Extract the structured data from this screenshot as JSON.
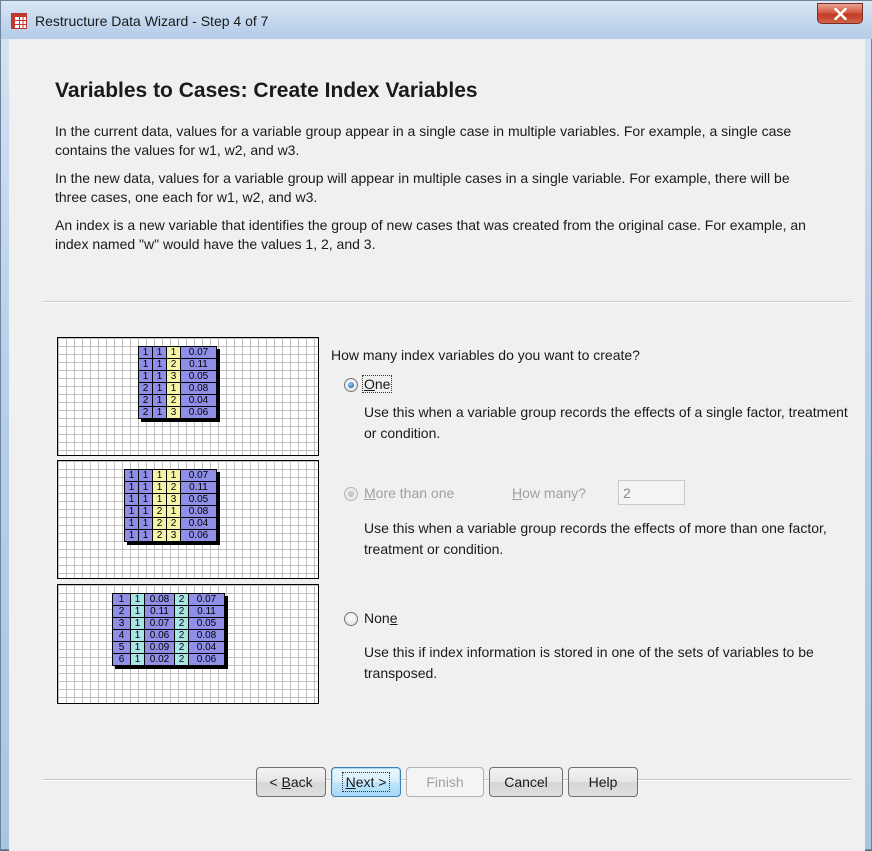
{
  "window": {
    "title": "Restructure Data Wizard - Step 4 of 7",
    "icon": "spreadsheet-icon",
    "close_icon": "close-icon"
  },
  "page": {
    "title": "Variables to Cases: Create Index Variables",
    "para1": "In the current data, values for a variable group appear in a single case in multiple variables.  For example, a single case contains the values for w1, w2, and w3.",
    "para2": "In the new data, values for a variable group will appear in multiple cases in a single variable.  For example, there will be three cases, one each for w1, w2, and w3.",
    "para3": "An index is a new variable that identifies the group of new cases that was created from the original case.  For example, an index named \"w\" would have the values 1, 2, and 3."
  },
  "diagrams": {
    "one": [
      [
        "1",
        "1",
        "1",
        "0.07"
      ],
      [
        "1",
        "1",
        "2",
        "0.11"
      ],
      [
        "1",
        "1",
        "3",
        "0.05"
      ],
      [
        "2",
        "1",
        "1",
        "0.08"
      ],
      [
        "2",
        "1",
        "2",
        "0.04"
      ],
      [
        "2",
        "1",
        "3",
        "0.06"
      ]
    ],
    "more": [
      [
        "1",
        "1",
        "1",
        "1",
        "0.07"
      ],
      [
        "1",
        "1",
        "1",
        "2",
        "0.11"
      ],
      [
        "1",
        "1",
        "1",
        "3",
        "0.05"
      ],
      [
        "1",
        "1",
        "2",
        "1",
        "0.08"
      ],
      [
        "1",
        "1",
        "2",
        "2",
        "0.04"
      ],
      [
        "1",
        "1",
        "2",
        "3",
        "0.06"
      ]
    ],
    "none": [
      [
        "1",
        "1",
        "0.08",
        "2",
        "0.07"
      ],
      [
        "2",
        "1",
        "0.11",
        "2",
        "0.11"
      ],
      [
        "3",
        "1",
        "0.07",
        "2",
        "0.05"
      ],
      [
        "4",
        "1",
        "0.06",
        "2",
        "0.08"
      ],
      [
        "5",
        "1",
        "0.09",
        "2",
        "0.04"
      ],
      [
        "6",
        "1",
        "0.02",
        "2",
        "0.06"
      ]
    ]
  },
  "options": {
    "question": "How many index variables do you want to create?",
    "one": {
      "label_u": "O",
      "label_rest": "ne",
      "checked": true,
      "desc": "Use this when a variable group records the effects of a single factor, treatment or condition."
    },
    "more": {
      "label_u": "M",
      "label_rest": "ore than one",
      "howmany_u": "H",
      "howmany_rest": "ow many?",
      "howmany_value": "2",
      "enabled": false,
      "desc": "Use this when a variable group records the effects of more than one factor, treatment or condition."
    },
    "none": {
      "label_pre": "Non",
      "label_u": "e",
      "desc": "Use this if index information is stored in one of the sets of variables to be transposed."
    }
  },
  "buttons": {
    "back_pre": "< ",
    "back_u": "B",
    "back_rest": "ack",
    "next_u": "N",
    "next_rest": "ext >",
    "finish": "Finish",
    "cancel": "Cancel",
    "help": "Help"
  }
}
